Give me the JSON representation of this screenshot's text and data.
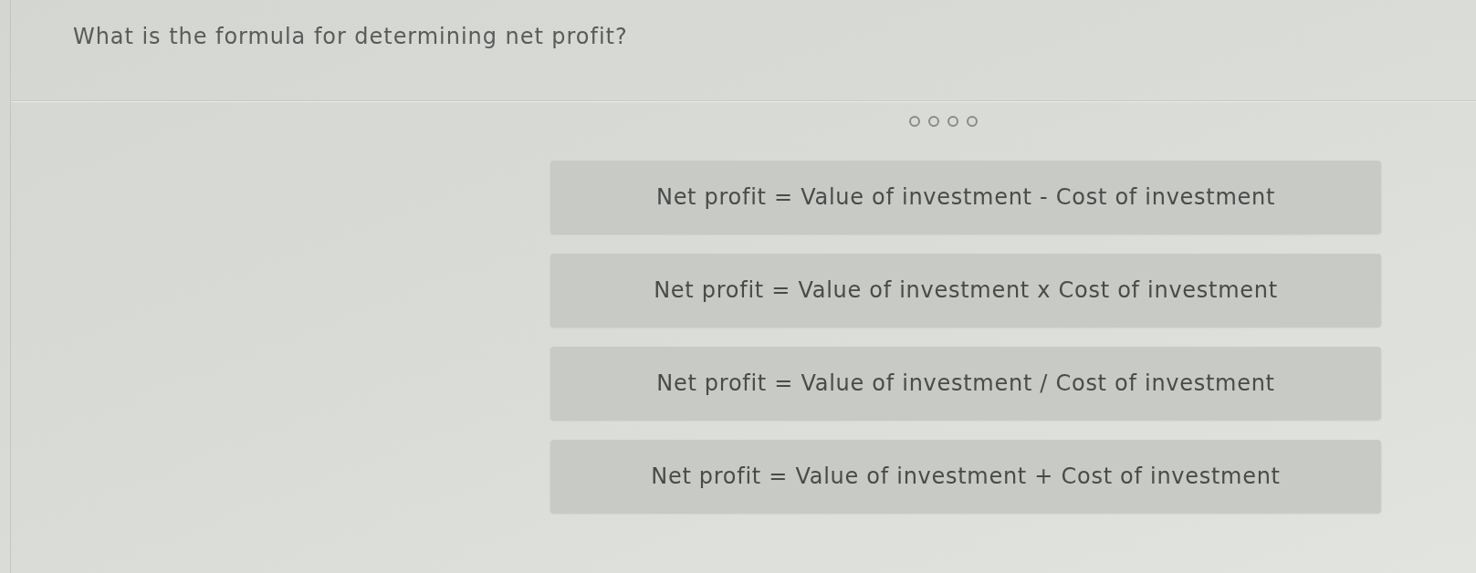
{
  "question": {
    "text": "What is the formula for determining net profit?"
  },
  "options": [
    {
      "text": "Net profit = Value of investment - Cost of investment"
    },
    {
      "text": "Net profit = Value of investment x Cost of investment"
    },
    {
      "text": "Net profit = Value of investment / Cost of investment"
    },
    {
      "text": "Net profit = Value of investment + Cost of investment"
    }
  ]
}
